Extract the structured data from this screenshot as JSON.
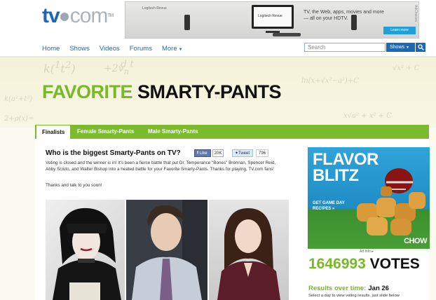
{
  "header": {
    "logo": {
      "part1": "tv",
      "part2": "com",
      "tm": "TM"
    },
    "nav": [
      {
        "label": "Home"
      },
      {
        "label": "Shows"
      },
      {
        "label": "Videos"
      },
      {
        "label": "Forums"
      },
      {
        "label": "More"
      }
    ],
    "search_placeholder": "Search",
    "search_scope": "Shows"
  },
  "top_ad": {
    "brand": "Logitech Revue",
    "text": "TV, the Web, apps, movies and more— all on your HDTV.",
    "button": "Learn more",
    "choices": "AdChoices"
  },
  "hero": {
    "title_green": "FAVORITE",
    "title_black": "SMARTY-PANTS"
  },
  "tabs": [
    {
      "label": "Finalists",
      "active": true
    },
    {
      "label": "Female Smarty-Pants",
      "active": false
    },
    {
      "label": "Male Smarty-Pants",
      "active": false
    }
  ],
  "article": {
    "question": "Who is the biggest Smarty-Pants on TV?",
    "fb_like_label": "Like",
    "fb_count": "20K",
    "tweet_label": "Tweet",
    "tweet_count": "796",
    "body": "Voting is closed and the winner is in! It's been a fierce battle that put Dr. Temperance \"Bones\" Brennan, Spencer Reid, Abby Sciuto, and Walter Bishop into a heated battle for your Favorite Smarty-Pants. Thanks for playing, TV.com fans!",
    "thanks": "Thanks and talk to you soon!"
  },
  "side_ad": {
    "title_line1": "FLAVOR",
    "title_line2": "BLITZ",
    "tagline": "GET GAME DAY RECIPES »",
    "brand": "CHOW",
    "ad_info": "Ad Info ▸"
  },
  "votes": {
    "count": "1646993",
    "label": "VOTES"
  },
  "results": {
    "label": "Results over time:",
    "date": "Jan 26",
    "hint": "Select a day to view voting results, just slide below"
  },
  "colors": {
    "brand_blue": "#1d67b4",
    "accent_green": "#78b829",
    "tab_green": "#7dbb2e"
  }
}
